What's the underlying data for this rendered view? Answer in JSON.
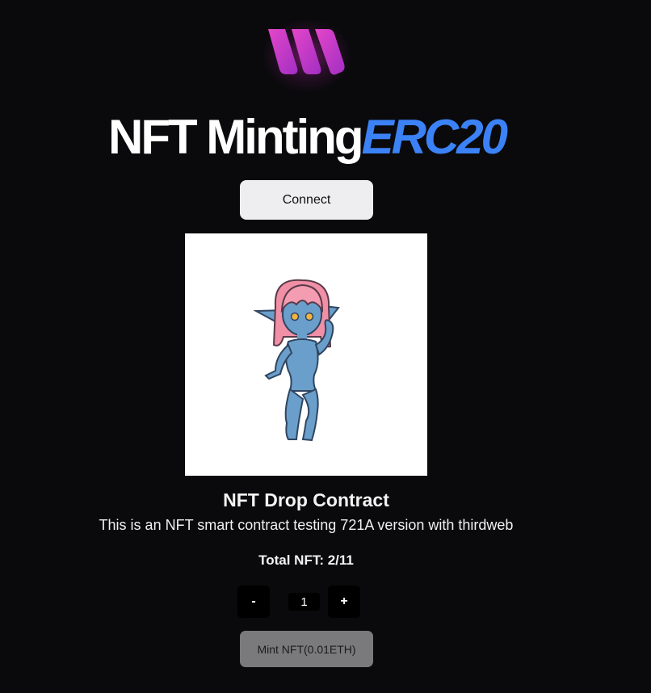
{
  "header": {
    "title_main": "NFT Minting",
    "title_accent": "ERC20",
    "logo_icon": "brand-logo-icon"
  },
  "wallet": {
    "connect_label": "Connect"
  },
  "nft": {
    "name": "NFT Drop Contract",
    "description": "This is an NFT smart contract testing 721A version with thirdweb",
    "image_icon": "nft-character-image"
  },
  "supply": {
    "total_label": "Total NFT: 2/11",
    "claimed": 2,
    "max": 11
  },
  "quantity": {
    "decrement_label": "-",
    "increment_label": "+",
    "value": "1"
  },
  "mint": {
    "label": "Mint NFT(0.01ETH)"
  },
  "colors": {
    "background": "#0a0a0c",
    "accent": "#3b82f6",
    "logo_gradient_start": "#e040c8",
    "logo_gradient_end": "#9b2fc0",
    "button_light": "#eeeef0",
    "button_disabled": "#7a7a7c"
  }
}
